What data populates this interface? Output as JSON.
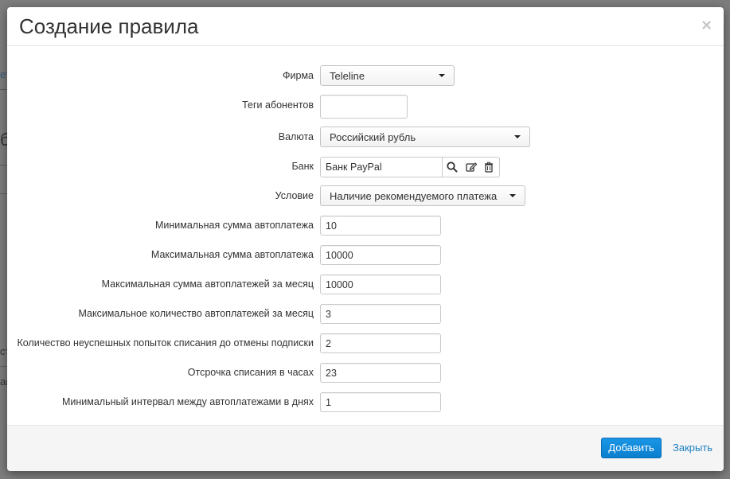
{
  "background": {
    "fragments": [
      "ет",
      "б",
      "ст",
      "ан"
    ]
  },
  "dialog": {
    "title": "Создание правила",
    "close_glyph": "×"
  },
  "form": {
    "firm": {
      "label": "Фирма",
      "value": "Teleline"
    },
    "tags": {
      "label": "Теги абонентов",
      "value": ""
    },
    "currency": {
      "label": "Валюта",
      "value": "Российский рубль"
    },
    "bank": {
      "label": "Банк",
      "value": "Банк PayPal",
      "icons": [
        "search-icon",
        "edit-icon",
        "trash-icon"
      ]
    },
    "condition": {
      "label": "Условие",
      "value": "Наличие рекомендуемого платежа"
    },
    "min_amount": {
      "label": "Минимальная сумма автоплатежа",
      "value": "10"
    },
    "max_amount": {
      "label": "Максимальная сумма автоплатежа",
      "value": "10000"
    },
    "max_month_amount": {
      "label": "Максимальная сумма автоплатежей за месяц",
      "value": "10000"
    },
    "max_month_count": {
      "label": "Максимальное количество автоплатежей за месяц",
      "value": "3"
    },
    "failed_attempts": {
      "label": "Количество неуспешных попыток списания до отмены подписки",
      "value": "2"
    },
    "delay_hours": {
      "label": "Отсрочка списания в часах",
      "value": "23"
    },
    "min_interval_days": {
      "label": "Минимальный интервал между автоплатежами в днях",
      "value": "1"
    }
  },
  "footer": {
    "add_label": "Добавить",
    "close_label": "Закрыть"
  },
  "colors": {
    "primary": "#0a7fce",
    "link": "#1a7fc1",
    "backdrop": "#7d7d7d"
  }
}
